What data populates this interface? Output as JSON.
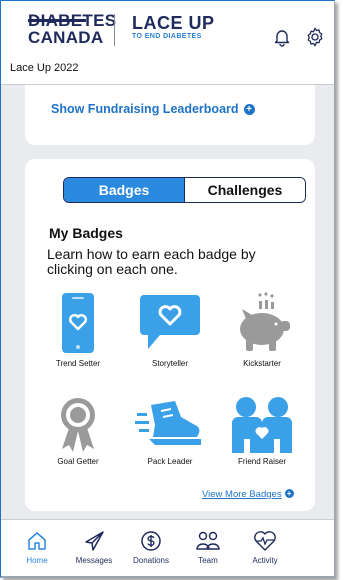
{
  "header": {
    "brand_line1": "DIABETES",
    "brand_line2": "CANADA",
    "event_logo_main": "LACE UP",
    "event_logo_sub": "TO END DIABETES",
    "event_name": "Lace Up 2022"
  },
  "leaderboard": {
    "link_label": "Show Fundraising Leaderboard",
    "plus": "+"
  },
  "tabs": {
    "badges": "Badges",
    "challenges": "Challenges"
  },
  "badges_section": {
    "title": "My Badges",
    "description": "Learn how to earn each badge by clicking on each one.",
    "badges": [
      {
        "label": "Trend Setter",
        "icon": "phone-heart-icon"
      },
      {
        "label": "Storyteller",
        "icon": "speech-heart-icon"
      },
      {
        "label": "Kickstarter",
        "icon": "piggy-bank-icon"
      },
      {
        "label": "Goal Getter",
        "icon": "award-ribbon-icon"
      },
      {
        "label": "Pack Leader",
        "icon": "running-shoe-icon"
      },
      {
        "label": "Friend Raiser",
        "icon": "two-people-heart-icon"
      }
    ],
    "view_more": "View More Badges",
    "active_color": "#2a8ae0",
    "earned_color": "#3aa0e8",
    "locked_color": "#9a9a9a"
  },
  "nav": [
    {
      "label": "Home",
      "icon": "home-icon",
      "active": true
    },
    {
      "label": "Messages",
      "icon": "send-icon",
      "active": false
    },
    {
      "label": "Donations",
      "icon": "dollar-icon",
      "active": false
    },
    {
      "label": "Team",
      "icon": "team-icon",
      "active": false
    },
    {
      "label": "Activity",
      "icon": "heart-pulse-icon",
      "active": false
    }
  ]
}
